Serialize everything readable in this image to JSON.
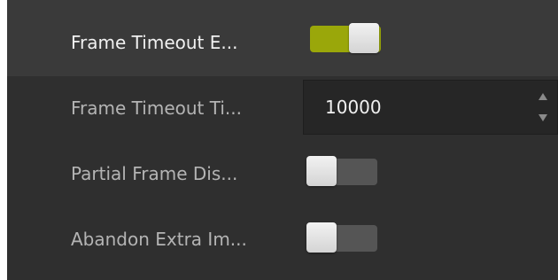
{
  "rows": [
    {
      "label": "Frame Timeout E...",
      "control": "toggle",
      "state": "on"
    },
    {
      "label": "Frame Timeout Ti...",
      "control": "number",
      "value": "10000"
    },
    {
      "label": "Partial Frame Dis...",
      "control": "toggle",
      "state": "off"
    },
    {
      "label": "Abandon Extra Im...",
      "control": "toggle",
      "state": "off"
    }
  ],
  "colors": {
    "panel_bg": "#2f2f2f",
    "highlight_row_bg": "#3a3a3a",
    "toggle_on": "#9aa70a",
    "toggle_off": "#555555",
    "input_bg": "#262626"
  },
  "icons": [
    "spin-up-arrow-icon",
    "spin-down-arrow-icon"
  ]
}
